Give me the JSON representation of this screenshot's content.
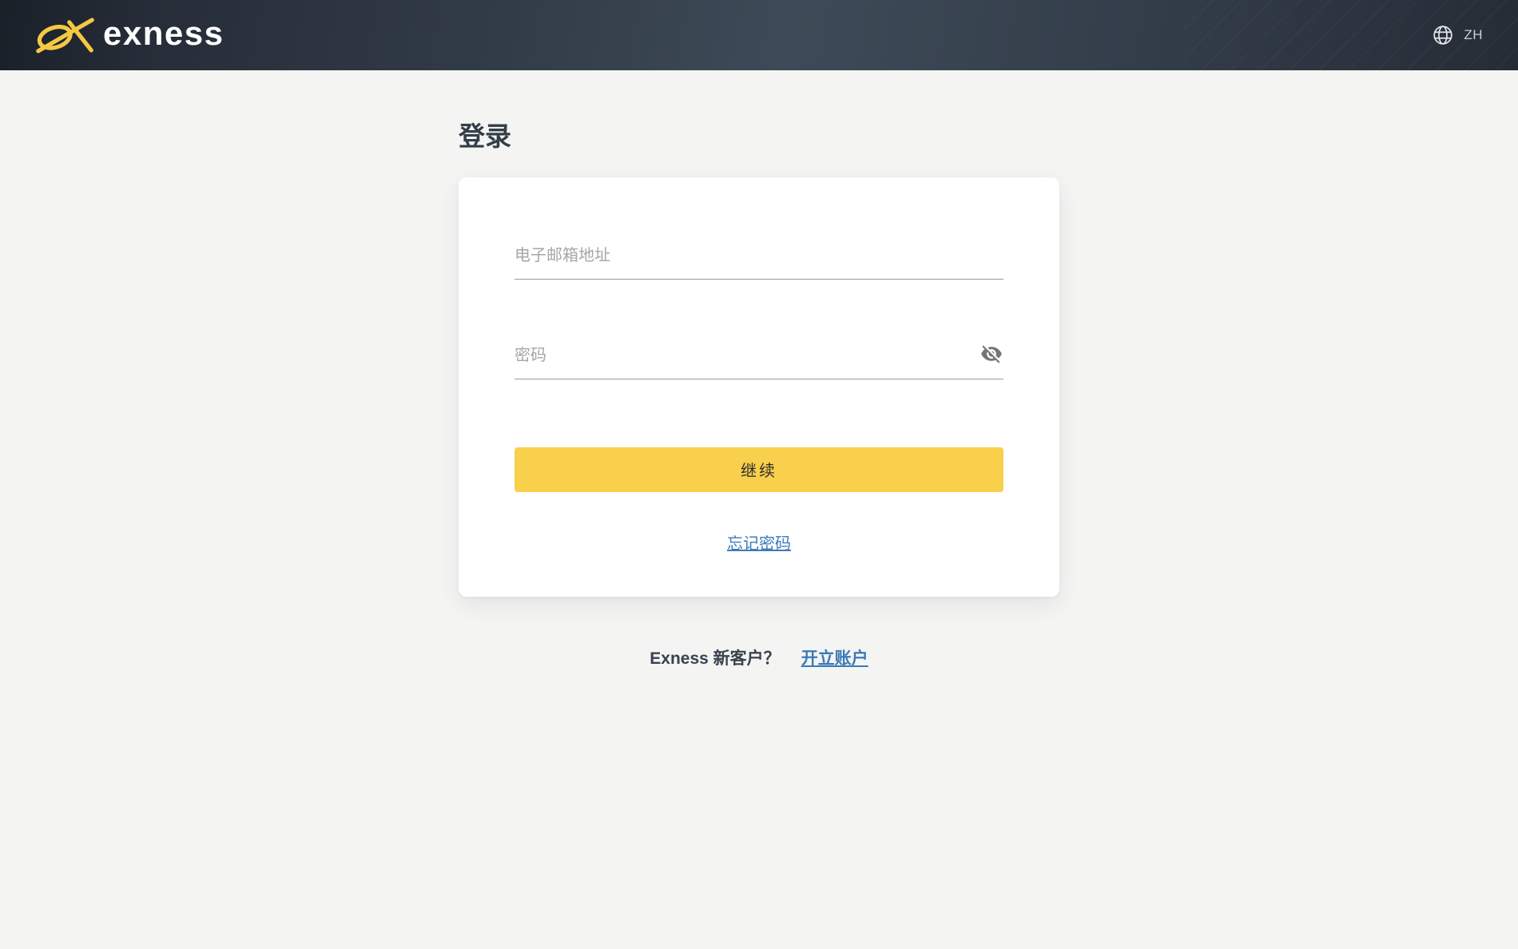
{
  "header": {
    "brand": "exness",
    "language": {
      "code": "ZH",
      "icon": "globe-icon"
    }
  },
  "login": {
    "title": "登录",
    "email": {
      "placeholder": "电子邮箱地址",
      "value": ""
    },
    "password": {
      "placeholder": "密码",
      "value": "",
      "visibility_icon": "eye-slash-icon",
      "visibility_state": "hidden"
    },
    "continue_label": "继续",
    "forgot_password_label": "忘记密码"
  },
  "signup": {
    "prompt": "Exness 新客户？",
    "open_account_label": "开立账户"
  },
  "colors": {
    "brand_yellow": "#F8D04C",
    "logo_yellow": "#F5C843",
    "header_bg_dark": "#232A34",
    "header_bg_light": "#3E4A57",
    "link_blue": "#3B7AB8",
    "page_bg": "#F4F4F3",
    "card_bg": "#FFFFFF",
    "text_dark": "#333E49",
    "placeholder_gray": "#A6A6A6",
    "input_underline": "#9B9B9B",
    "eye_icon_gray": "#757575"
  }
}
